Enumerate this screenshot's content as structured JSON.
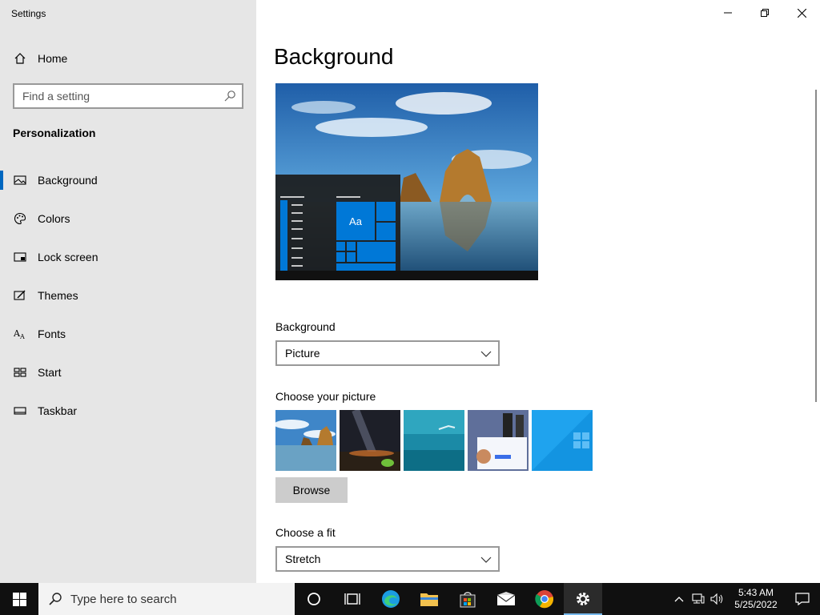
{
  "window": {
    "title": "Settings",
    "controls": {
      "minimize": "minimize-icon",
      "restore": "restore-icon",
      "close": "close-icon"
    }
  },
  "sidebar": {
    "home_label": "Home",
    "search_placeholder": "Find a setting",
    "section_title": "Personalization",
    "items": [
      {
        "label": "Background",
        "icon": "picture-icon",
        "active": true
      },
      {
        "label": "Colors",
        "icon": "palette-icon",
        "active": false
      },
      {
        "label": "Lock screen",
        "icon": "lock-screen-icon",
        "active": false
      },
      {
        "label": "Themes",
        "icon": "themes-icon",
        "active": false
      },
      {
        "label": "Fonts",
        "icon": "fonts-icon",
        "active": false
      },
      {
        "label": "Start",
        "icon": "start-icon",
        "active": false
      },
      {
        "label": "Taskbar",
        "icon": "taskbar-icon",
        "active": false
      }
    ]
  },
  "main": {
    "page_title": "Background",
    "preview_tile_label": "Aa",
    "background_label": "Background",
    "background_value": "Picture",
    "choose_picture_label": "Choose your picture",
    "browse_label": "Browse",
    "choose_fit_label": "Choose a fit",
    "fit_value": "Stretch"
  },
  "taskbar": {
    "search_placeholder": "Type here to search",
    "time": "5:43 AM",
    "date": "5/25/2022",
    "accent": "#76b9ed"
  },
  "colors": {
    "accent": "#0067c0",
    "sidebar_bg": "#e6e6e6",
    "tile_blue": "#0078d7"
  }
}
